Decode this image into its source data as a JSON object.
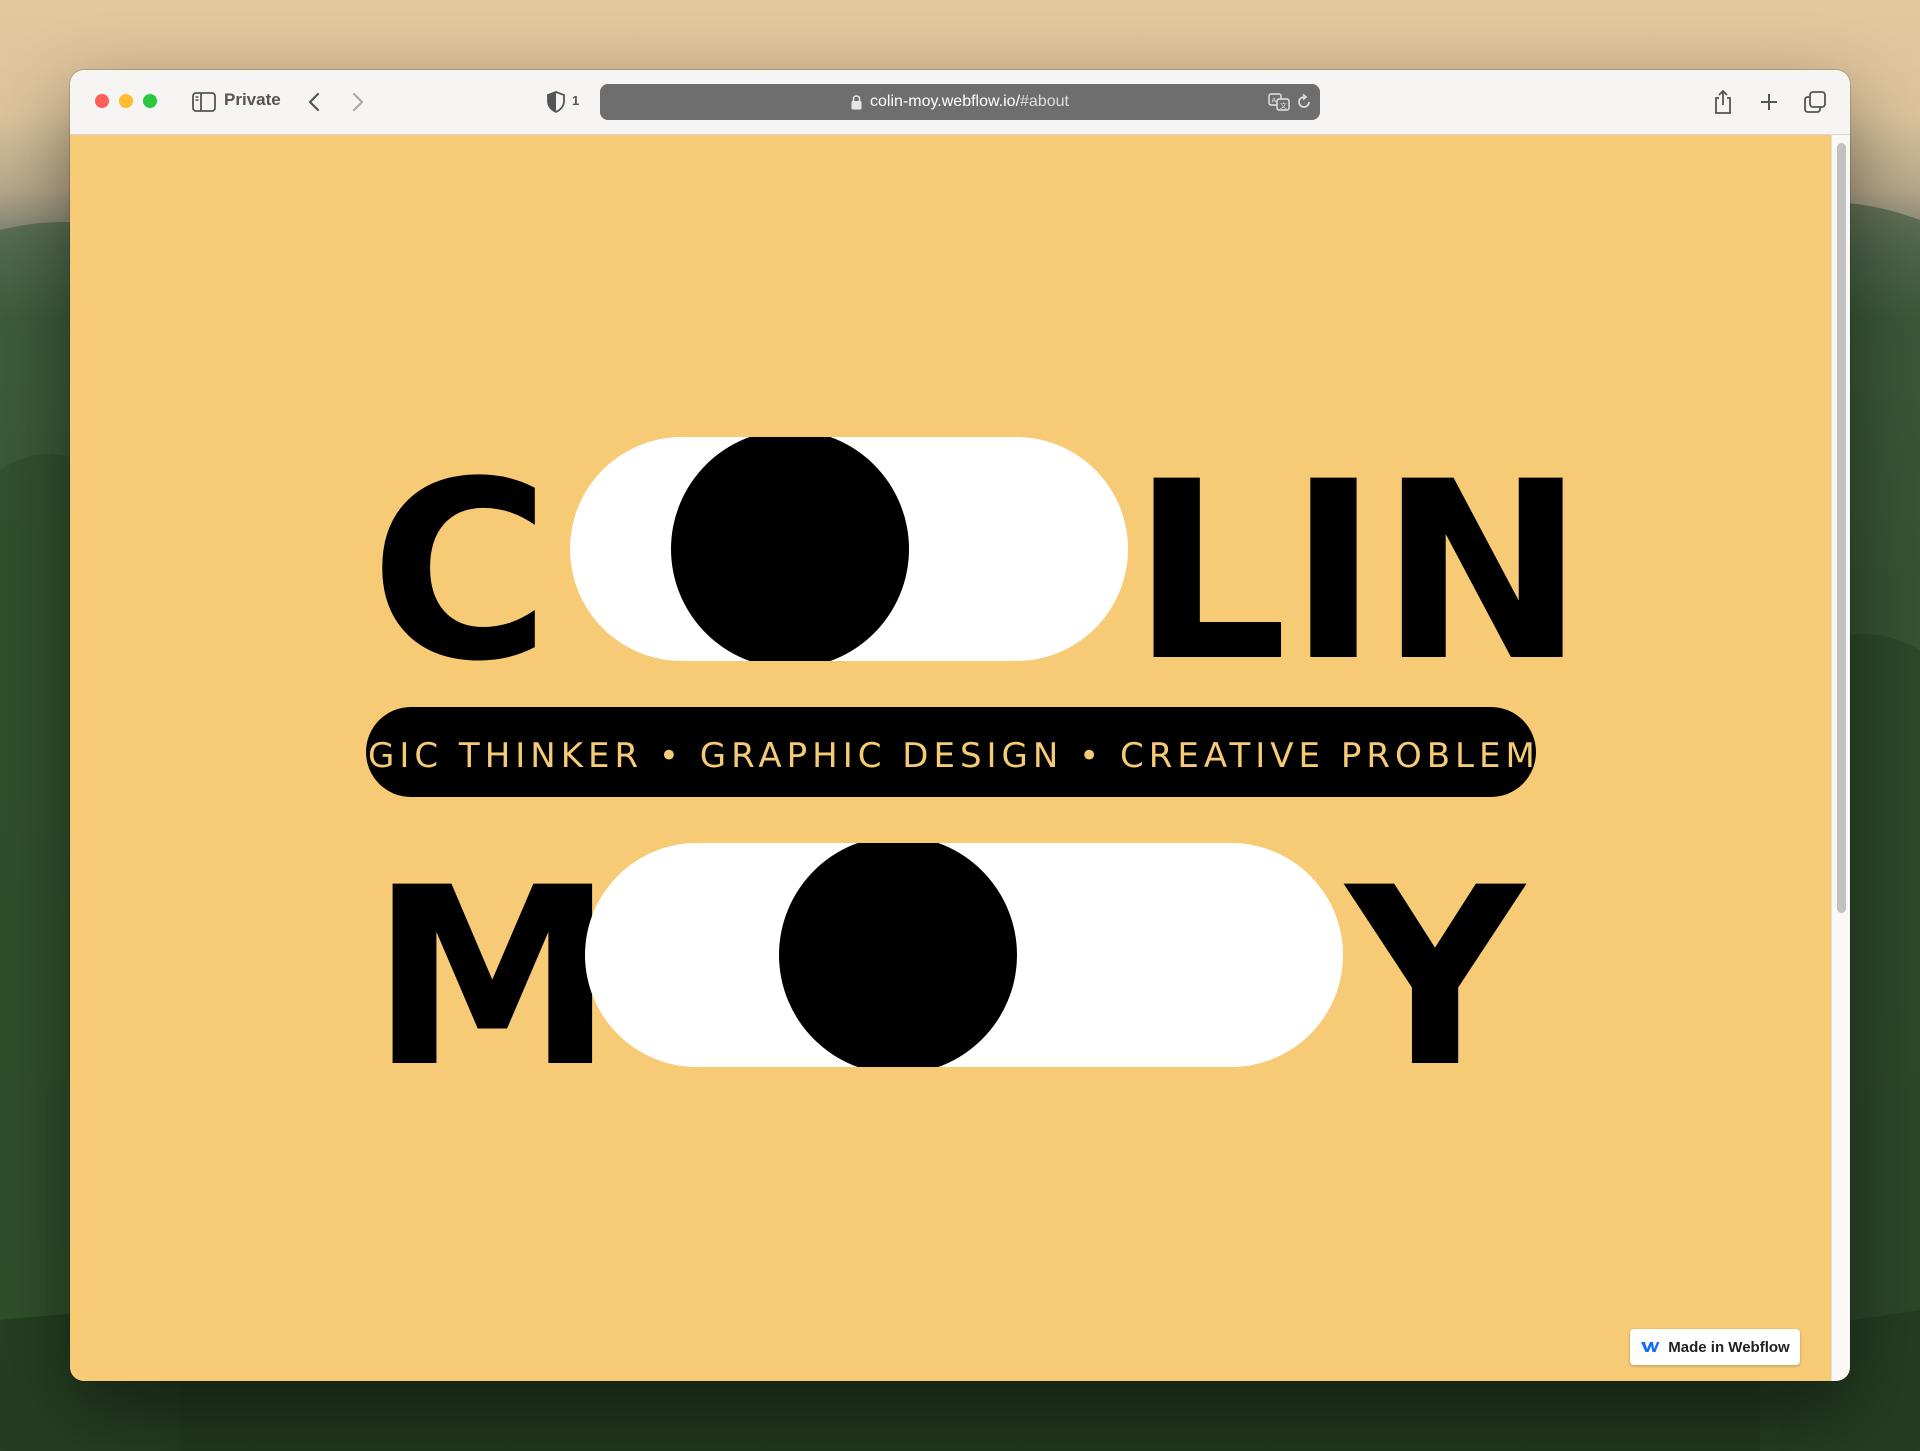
{
  "browser": {
    "mode_label": "Private",
    "shield_count": "1",
    "url_host": "colin-moy.webflow.io/",
    "url_path": "#about"
  },
  "hero": {
    "first_name_start": "C",
    "first_name_end": "LIN",
    "last_name_start": "M",
    "last_name_end": "Y",
    "ticker_text": "GIC THINKER • GRAPHIC DESIGN • CREATIVE PROBLEM SO",
    "colors": {
      "background": "#f7cb76",
      "ink": "#000000",
      "pill": "#ffffff",
      "ticker_text": "#f7cb76"
    }
  },
  "badge": {
    "label": "Made in Webflow",
    "icon": "webflow-logo-icon"
  },
  "icons": [
    "sidebar-icon",
    "back-icon",
    "forward-icon",
    "shield-icon",
    "lock-icon",
    "translate-icon",
    "reload-icon",
    "share-icon",
    "new-tab-icon",
    "tabs-overview-icon"
  ]
}
